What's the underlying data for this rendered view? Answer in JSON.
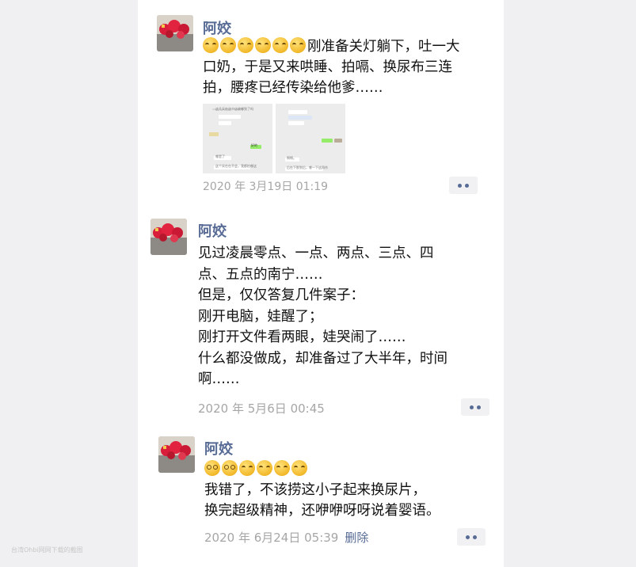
{
  "posts": [
    {
      "author": "阿姣",
      "emojis": [
        "sleepy",
        "sleepy",
        "sleepy",
        "sleepy",
        "sleepy",
        "sleepy"
      ],
      "lines": [
        "刚准备关灯躺下，吐一大",
        "口奶，于是又来哄睡、拍嗝、换尿布三连",
        "拍，腰疼已经传染给他爹……"
      ],
      "images": [
        {
          "name": "chat-screenshot-1",
          "texts": [
            "这几天在这个店收哪到了吗",
            "哪是了",
            "这个实在在不会，我都拍哪这"
          ],
          "green": "好的"
        },
        {
          "name": "chat-screenshot-2",
          "texts": [
            "啊啊。",
            "后在下那到后，哪一下这再作"
          ],
          "green": ""
        }
      ],
      "timestamp": "2020 年 3月19日 01:19"
    },
    {
      "author": "阿姣",
      "lines": [
        "见过凌晨零点、一点、两点、三点、四",
        "点、五点的南宁……",
        "但是，仅仅答复几件案子：",
        "刚开电脑，娃醒了；",
        "刚打开文件看两眼，娃哭闹了……",
        "什么都没做成，却准备过了大半年，时间",
        "啊……"
      ],
      "timestamp": "2020 年 5月6日 00:45"
    },
    {
      "author": "阿姣",
      "emojis": [
        "dizzy",
        "dizzy",
        "sleepy",
        "sleepy",
        "sleepy",
        "sleepy"
      ],
      "lines": [
        "我错了，不该捞这小子起来换尿片，",
        "换完超级精神，还咿咿呀呀说着婴语。"
      ],
      "timestamp": "2020 年 6月24日 05:39",
      "delete_label": "删除"
    }
  ],
  "watermark": "台湾Ohbi网网下载的截图",
  "colors": {
    "name": "#576b95",
    "timestamp": "#a6a6a6",
    "background": "#f0f0f2",
    "card": "#ffffff"
  }
}
